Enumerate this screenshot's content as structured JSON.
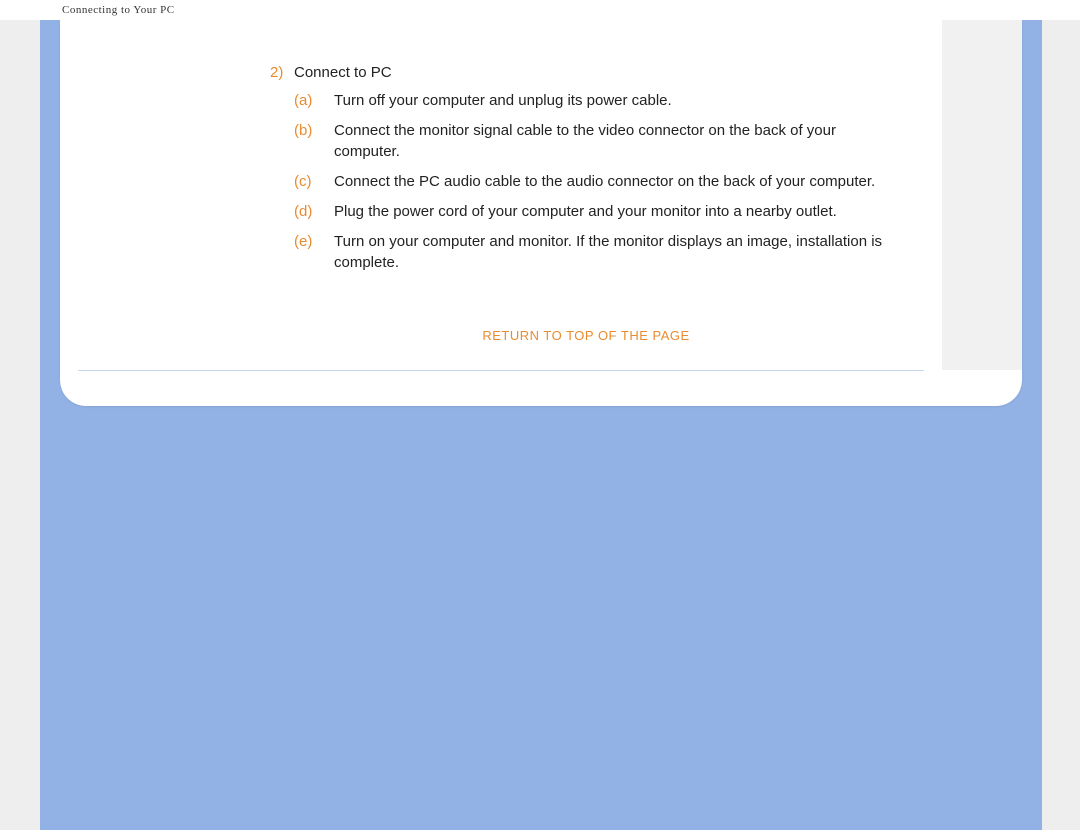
{
  "header": {
    "title": "Connecting to Your PC"
  },
  "step": {
    "number": "2)",
    "title": "Connect to PC",
    "items": [
      {
        "marker": "(a)",
        "text": "Turn off your computer and unplug its power cable."
      },
      {
        "marker": "(b)",
        "text": "Connect the monitor signal cable to the video connector on the back of your computer."
      },
      {
        "marker": "(c)",
        "text": "Connect the PC audio cable to the audio connector on the back of your computer."
      },
      {
        "marker": "(d)",
        "text": "Plug the power cord of your computer and your monitor into a nearby outlet."
      },
      {
        "marker": "(e)",
        "text": "Turn on your computer and monitor. If the monitor displays an image, installation is complete."
      }
    ]
  },
  "returnLink": "RETURN TO TOP OF THE PAGE"
}
